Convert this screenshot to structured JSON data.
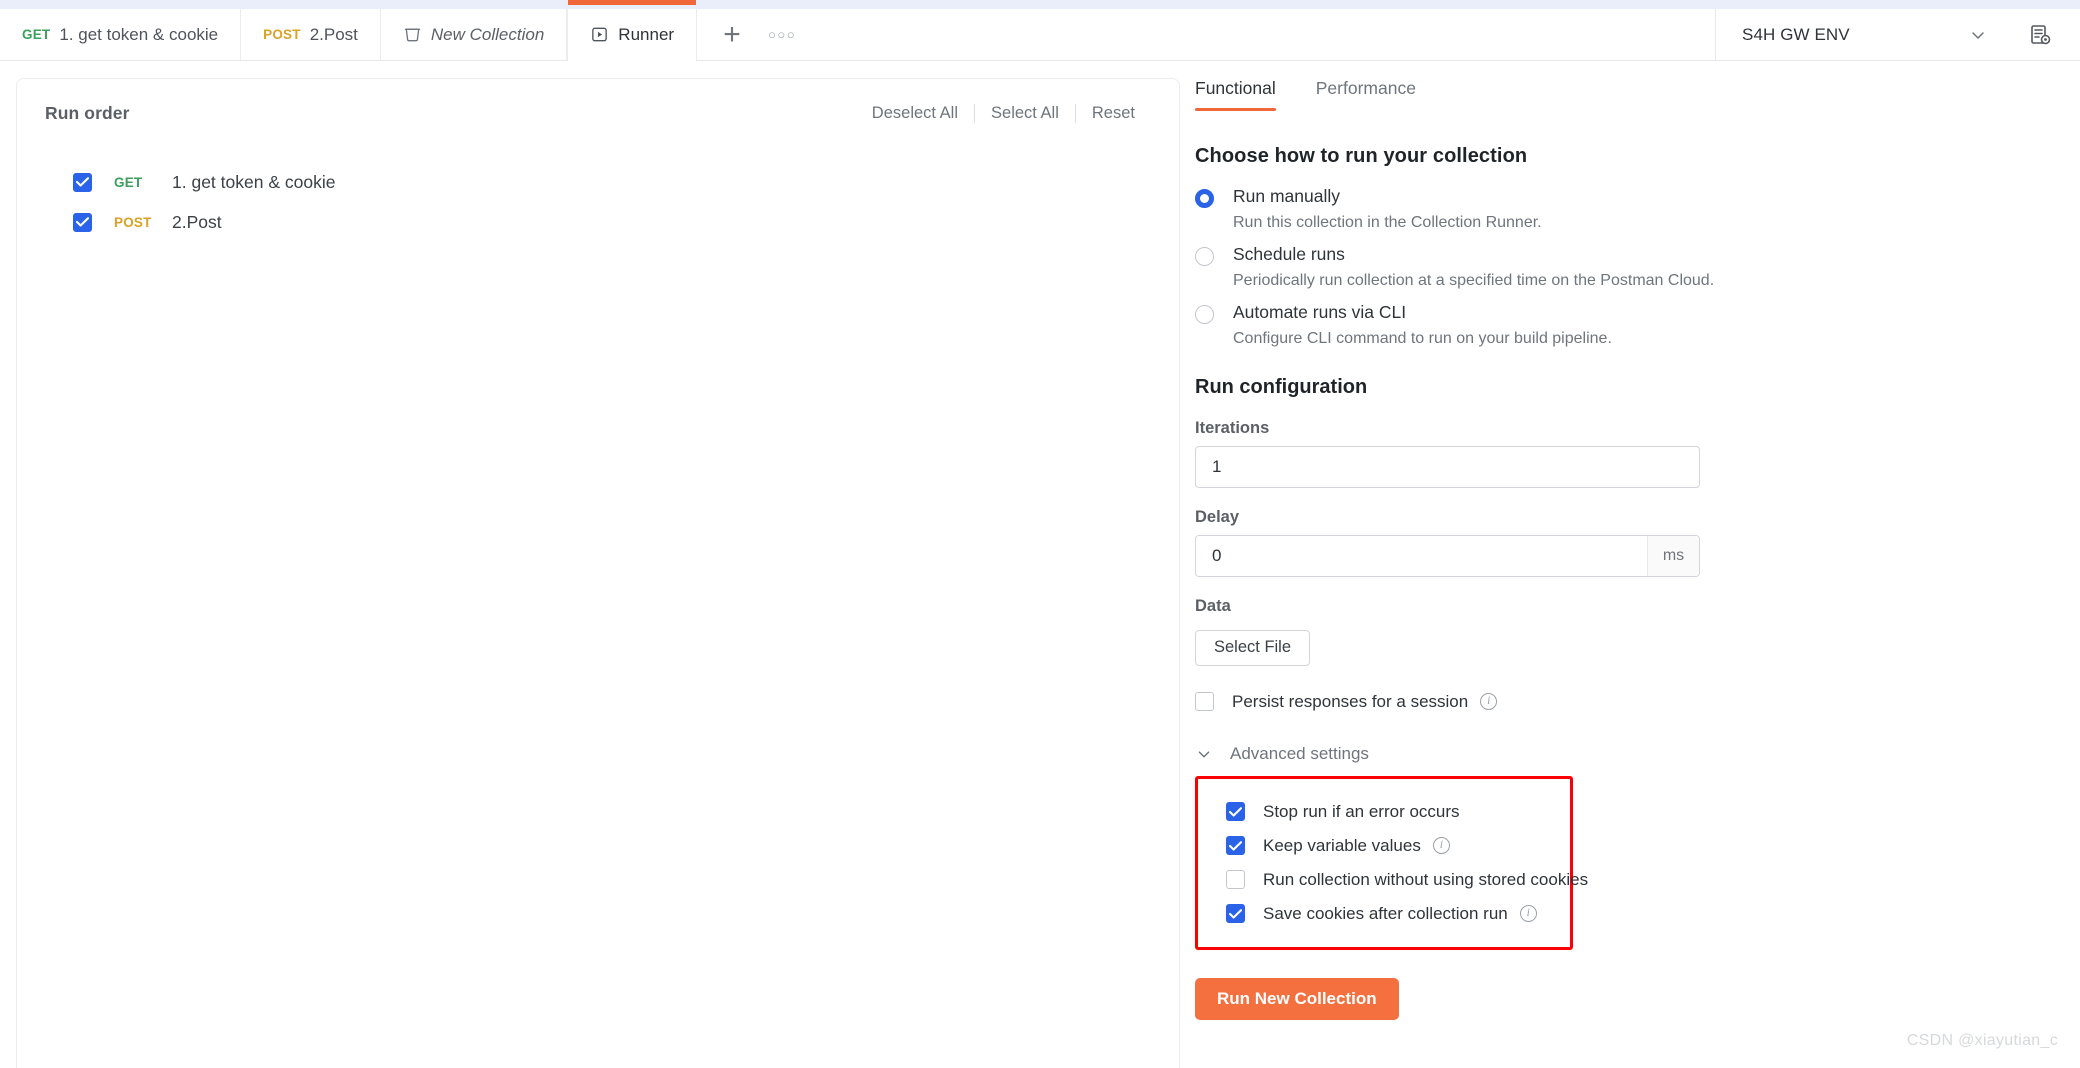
{
  "window": {
    "tabs": [
      {
        "method": "GET",
        "method_class": "m-get",
        "title": "1. get token & cookie",
        "icon": "",
        "active": false,
        "italic": false
      },
      {
        "method": "POST",
        "method_class": "m-post",
        "title": "2.Post",
        "icon": "",
        "active": false,
        "italic": false
      },
      {
        "method": "",
        "method_class": "",
        "title": "New Collection",
        "icon": "collection-icon",
        "active": false,
        "italic": true
      },
      {
        "method": "",
        "method_class": "",
        "title": "Runner",
        "icon": "runner-icon",
        "active": true,
        "italic": false
      }
    ],
    "new_tab_label": "+",
    "more_tabs_label": "●●●",
    "environment": {
      "name": "S4H GW ENV",
      "caret_icon": "chevron-down-icon",
      "eye_icon": "environment-quick-look-icon"
    }
  },
  "left_panel": {
    "title": "Run order",
    "actions": [
      {
        "label": "Deselect All"
      },
      {
        "label": "Select All"
      },
      {
        "label": "Reset"
      }
    ],
    "requests": [
      {
        "checked": true,
        "method": "GET",
        "method_class": "m-get",
        "name": "1. get token & cookie"
      },
      {
        "checked": true,
        "method": "POST",
        "method_class": "m-post",
        "name": "2.Post"
      }
    ]
  },
  "right_panel": {
    "tabs": [
      {
        "label": "Functional",
        "active": true
      },
      {
        "label": "Performance",
        "active": false
      }
    ],
    "choose_heading": "Choose how to run your collection",
    "run_modes": [
      {
        "selected": true,
        "label": "Run manually",
        "desc": "Run this collection in the Collection Runner."
      },
      {
        "selected": false,
        "label": "Schedule runs",
        "desc": "Periodically run collection at a specified time on the Postman Cloud."
      },
      {
        "selected": false,
        "label": "Automate runs via CLI",
        "desc": "Configure CLI command to run on your build pipeline."
      }
    ],
    "run_config_heading": "Run configuration",
    "iterations": {
      "label": "Iterations",
      "value": "1",
      "placeholder": "1"
    },
    "delay": {
      "label": "Delay",
      "value": "0",
      "placeholder": "0",
      "suffix": "ms"
    },
    "data": {
      "label": "Data",
      "select_file_label": "Select File"
    },
    "persist": {
      "checked": false,
      "label": "Persist responses for a session",
      "info": "i"
    },
    "advanced_toggle": {
      "label": "Advanced settings",
      "icon": "chevron-down-icon",
      "expanded": true
    },
    "advanced_settings": {
      "highlight_color": "#fb0103",
      "items": [
        {
          "checked": true,
          "label": "Stop run if an error occurs",
          "info": ""
        },
        {
          "checked": true,
          "label": "Keep variable values",
          "info": "i"
        },
        {
          "checked": false,
          "label": "Run collection without using stored cookies",
          "info": ""
        },
        {
          "checked": true,
          "label": "Save cookies after collection run",
          "info": "i"
        }
      ]
    },
    "run_button": {
      "label": "Run New Collection",
      "color": "#f4713f"
    }
  },
  "watermark": "CSDN @xiayutian_c"
}
